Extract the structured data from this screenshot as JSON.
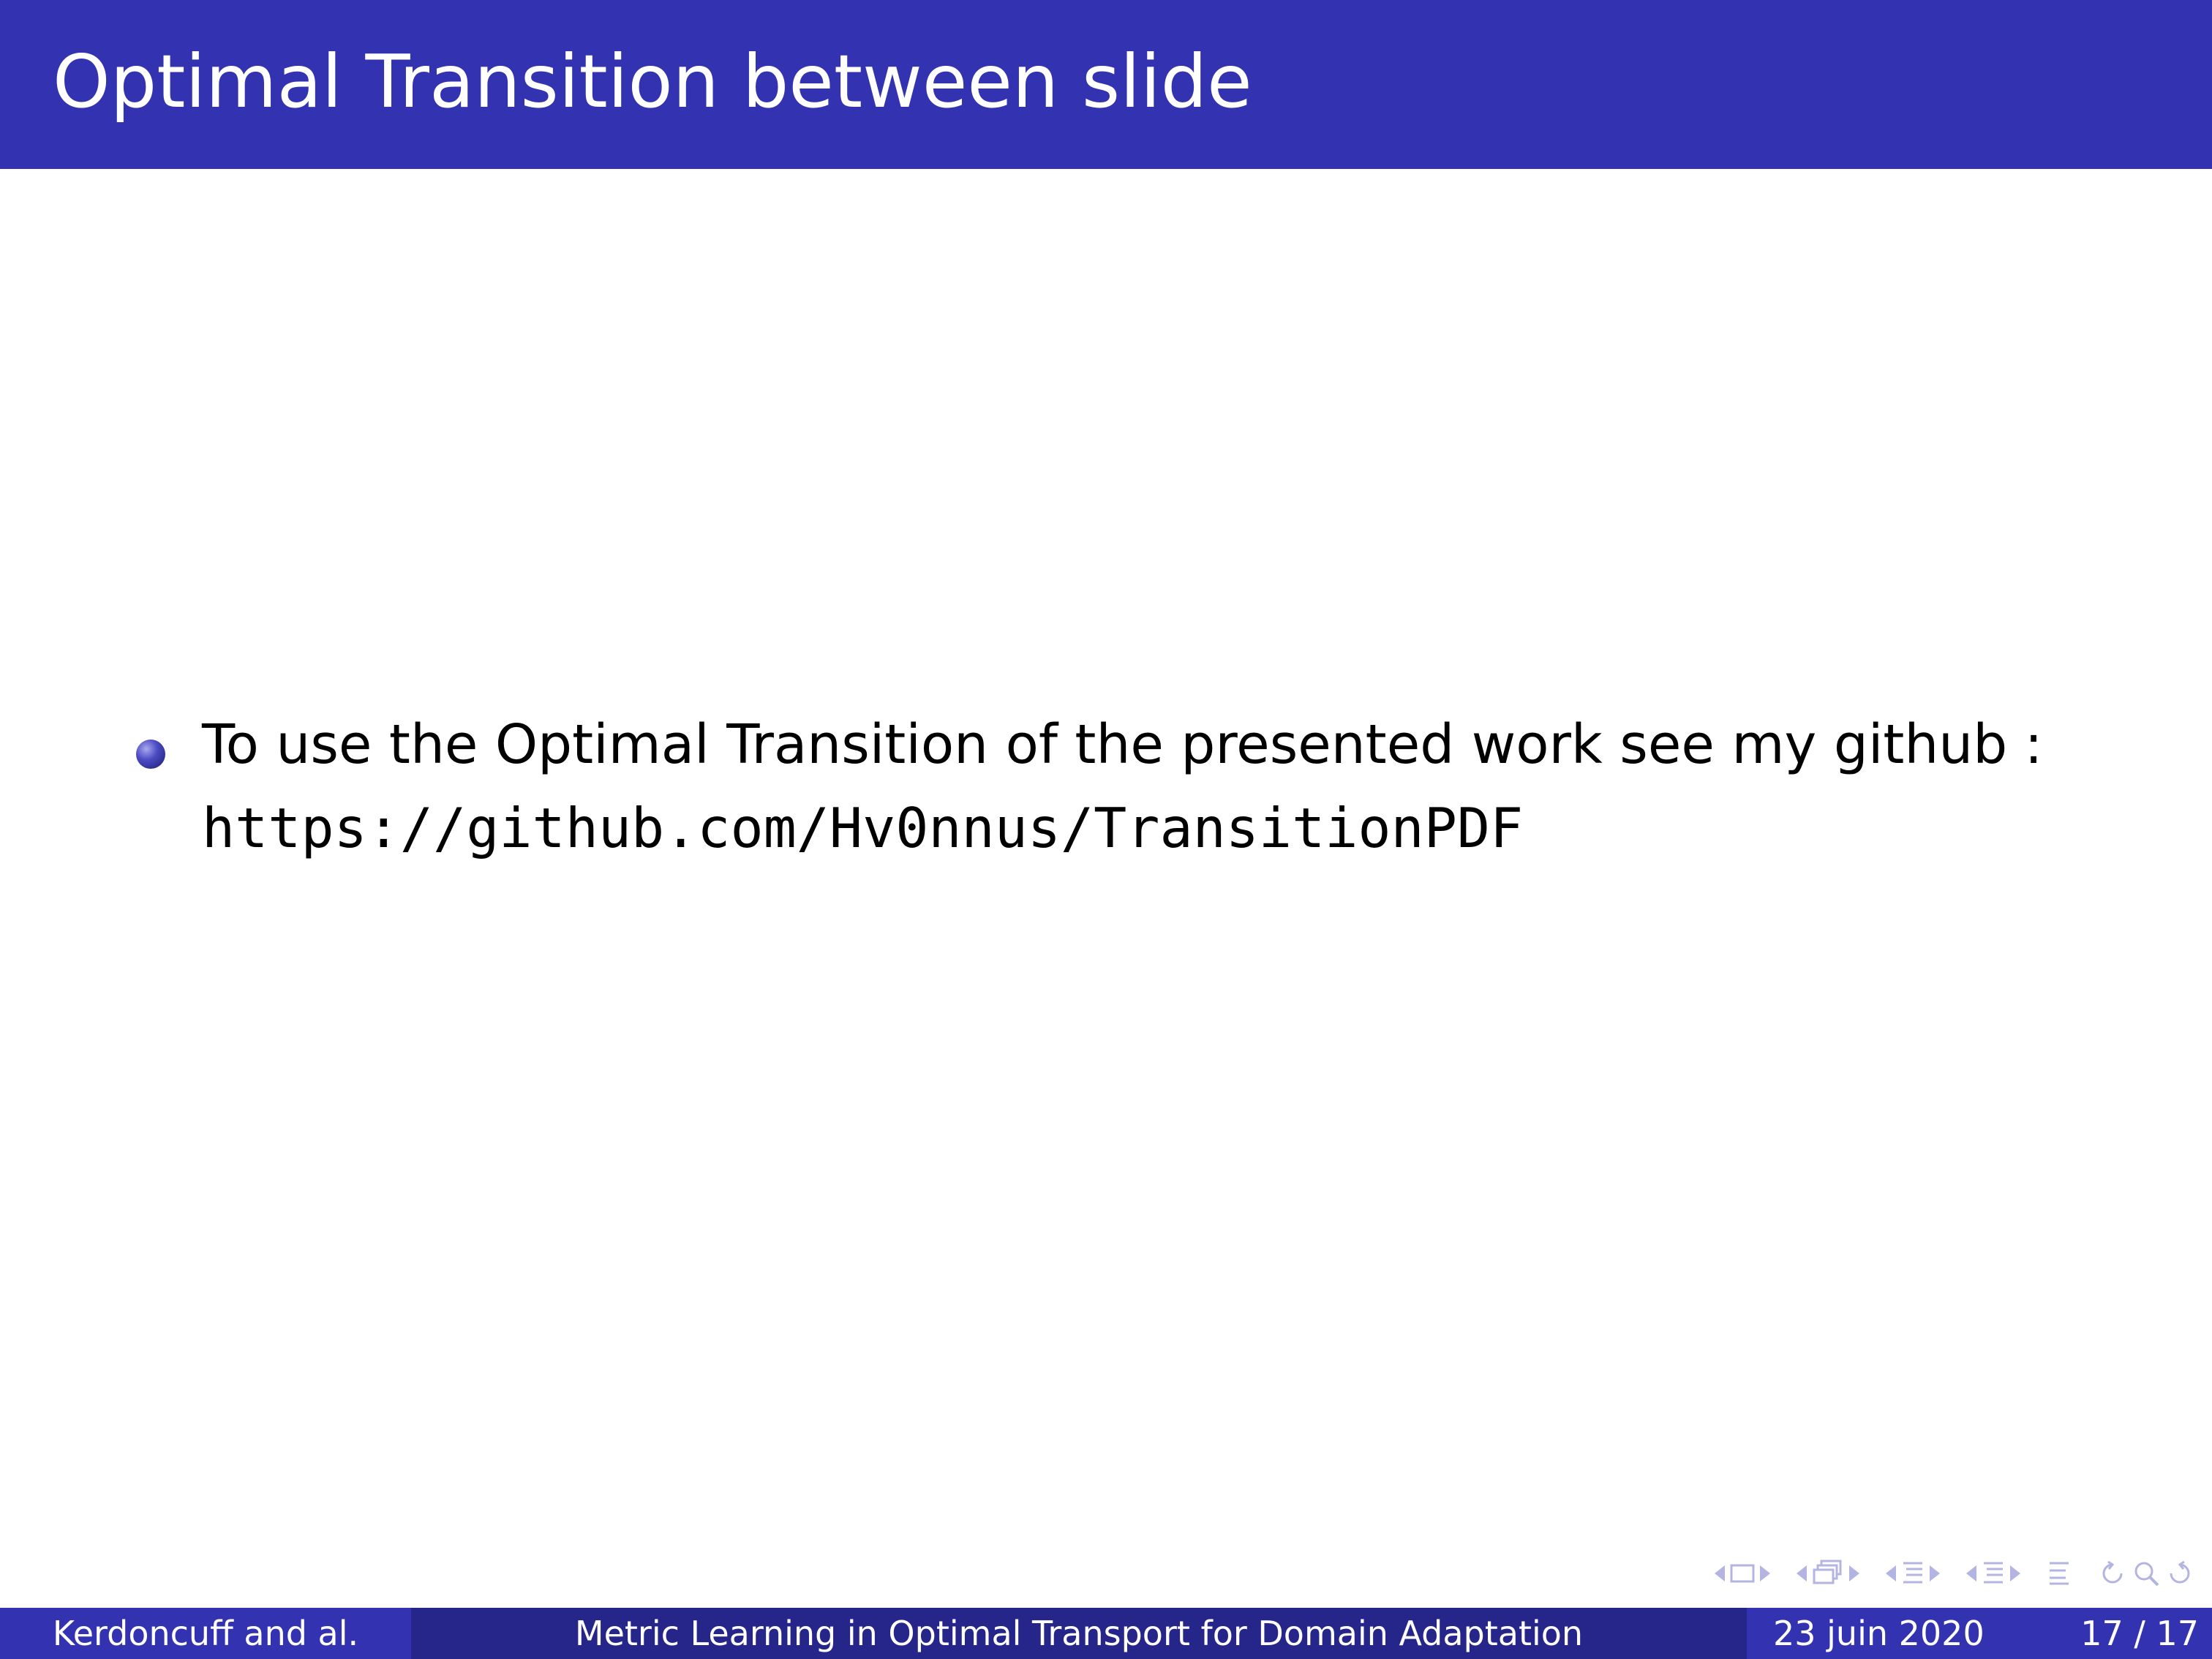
{
  "header": {
    "title": "Optimal Transition between slide"
  },
  "content": {
    "bullets": [
      {
        "text": "To use the Optimal Transition of the presented work see my github :",
        "url": "https://github.com/Hv0nnus/TransitionPDF"
      }
    ]
  },
  "navigation": {
    "icons": [
      "nav-frame-icon",
      "nav-subsection-icon",
      "nav-section-icon",
      "nav-part-icon",
      "nav-align-icon",
      "nav-search-icon"
    ]
  },
  "footer": {
    "author": "Kerdoncuff and al.",
    "title": "Metric Learning in Optimal Transport for Domain Adaptation",
    "date": "23 juin 2020",
    "page": "17 / 17"
  },
  "colors": {
    "header_bg": "#3333b2",
    "footer_mid_bg": "#26268a",
    "nav_icons": "#b4b4e2"
  }
}
